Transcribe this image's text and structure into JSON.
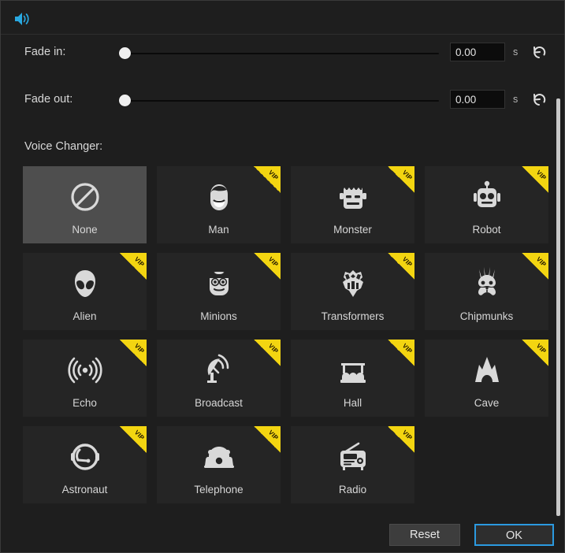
{
  "header": {
    "icon": "speaker-icon",
    "accent": "#29a8e0"
  },
  "fade_in": {
    "label": "Fade in:",
    "value": "0.00",
    "placeholder": "0.00",
    "unit": "s",
    "slider_position": 0,
    "reset_icon": "reset-arrow-icon"
  },
  "fade_out": {
    "label": "Fade out:",
    "value": "0.00",
    "placeholder": "0.00",
    "unit": "s",
    "slider_position": 0,
    "reset_icon": "reset-arrow-icon"
  },
  "voice_changer": {
    "label": "Voice Changer:",
    "vip_badge_text": "VIP",
    "vip_badge_color": "#f3d511",
    "selected": "None",
    "tiles": [
      {
        "label": "None",
        "icon": "no-entry-icon",
        "vip": false,
        "selected": true
      },
      {
        "label": "Man",
        "icon": "man-face-icon",
        "vip": true,
        "selected": false
      },
      {
        "label": "Monster",
        "icon": "monster-face-icon",
        "vip": true,
        "selected": false
      },
      {
        "label": "Robot",
        "icon": "robot-face-icon",
        "vip": true,
        "selected": false
      },
      {
        "label": "Alien",
        "icon": "alien-face-icon",
        "vip": true,
        "selected": false
      },
      {
        "label": "Minions",
        "icon": "minion-face-icon",
        "vip": true,
        "selected": false
      },
      {
        "label": "Transformers",
        "icon": "autobot-icon",
        "vip": true,
        "selected": false
      },
      {
        "label": "Chipmunks",
        "icon": "chipmunk-icon",
        "vip": true,
        "selected": false
      },
      {
        "label": "Echo",
        "icon": "echo-waves-icon",
        "vip": true,
        "selected": false
      },
      {
        "label": "Broadcast",
        "icon": "satellite-dish-icon",
        "vip": true,
        "selected": false
      },
      {
        "label": "Hall",
        "icon": "hall-seats-icon",
        "vip": true,
        "selected": false
      },
      {
        "label": "Cave",
        "icon": "cave-icon",
        "vip": true,
        "selected": false
      },
      {
        "label": "Astronaut",
        "icon": "astronaut-helmet-icon",
        "vip": true,
        "selected": false
      },
      {
        "label": "Telephone",
        "icon": "telephone-icon",
        "vip": true,
        "selected": false
      },
      {
        "label": "Radio",
        "icon": "radio-icon",
        "vip": true,
        "selected": false
      }
    ]
  },
  "footer": {
    "reset_label": "Reset",
    "ok_label": "OK",
    "ok_focus_color": "#2b9ae0"
  }
}
